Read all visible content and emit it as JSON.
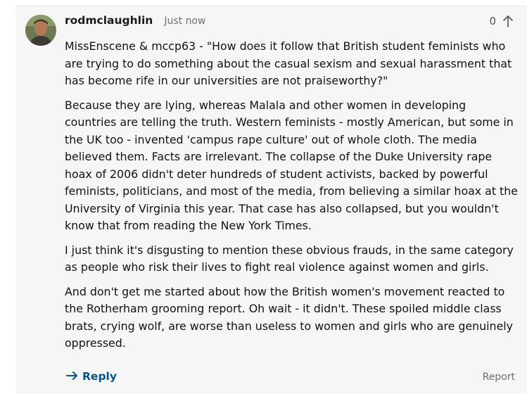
{
  "comment": {
    "username": "rodmclaughlin",
    "timestamp": "Just now",
    "vote_count": "0",
    "paragraphs": [
      "MissEnscene & mccp63 - \"How does it follow that British student feminists who are trying to do something about the casual sexism and sexual harassment that has become rife in our universities are not praiseworthy?\"",
      "Because they are lying, whereas Malala and other women in developing countries are telling the truth. Western feminists - mostly American, but some in the UK too - invented 'campus rape culture' out of whole cloth. The media believed them. Facts are irrelevant. The collapse of the Duke University rape hoax of 2006 didn't deter hundreds of student activists, backed by powerful feminists, politicians, and most of the media, from believing a similar hoax at the University of Virginia this year. That case has also collapsed, but you wouldn't know that from reading the New York Times.",
      "I just think it's disgusting to mention these obvious frauds, in the same category as people who risk their lives to fight real violence against women and girls.",
      "And don't get me started about how the British women's movement reacted to the Rotherham grooming report. Oh wait - it didn't. These spoiled middle class brats, crying wolf, are worse than useless to women and girls who are genuinely oppressed."
    ],
    "reply_label": "Reply",
    "report_label": "Report"
  },
  "colors": {
    "reply_blue": "#005689",
    "background": "#f6f6f6"
  },
  "icons": {
    "upvote": "arrow-up-icon",
    "reply": "arrow-right-icon",
    "avatar": "user-avatar"
  }
}
